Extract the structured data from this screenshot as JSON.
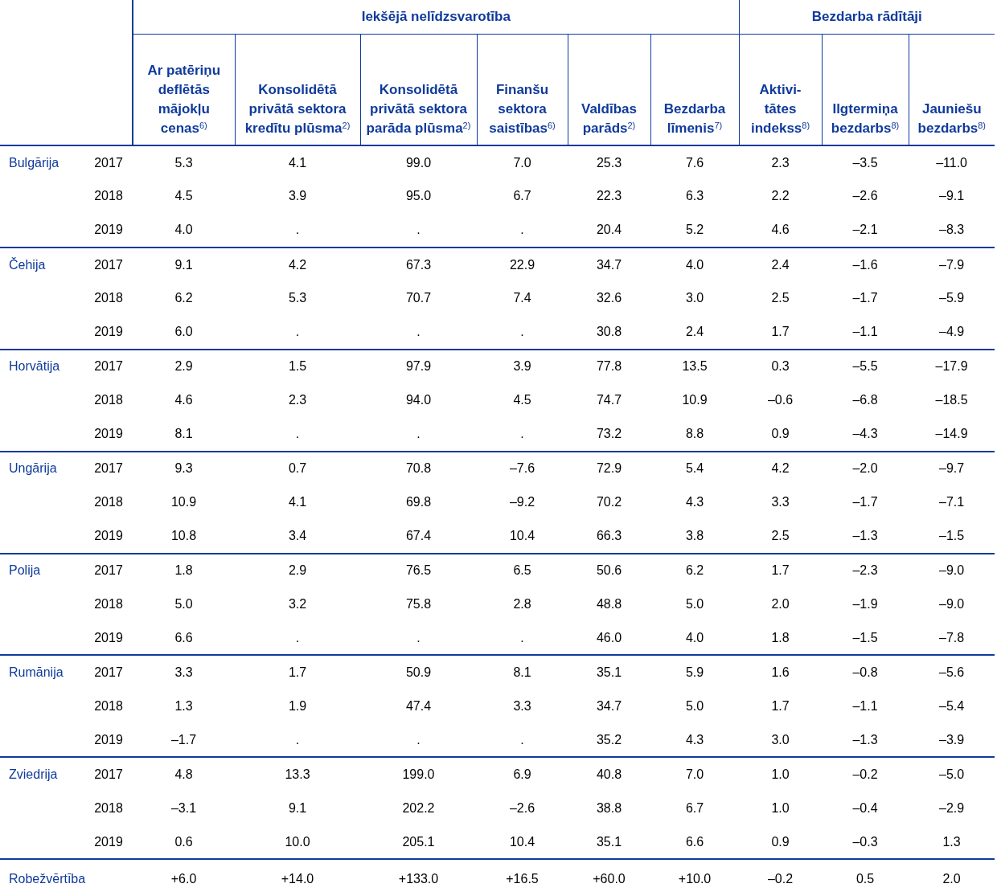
{
  "groups": [
    {
      "label": "Iekšējā nelīdzsvarotība",
      "columns": [
        "Ar patēriņu deflētās mājokļu cenas$^{6)}$",
        "Konsolidētā privātā sektora kredītu plūsma$^{2)}$",
        "Konsolidētā privātā sektora parāda plūsma$^{2)}$",
        "Finanšu sektora saistības$^{6)}$",
        "Valdības parāds$^{2)}$",
        "Bezdarba līmenis$^{7)}$"
      ]
    },
    {
      "label": "Bezdarba rādītāji",
      "columns": [
        "Aktivi-tātes indekss$^{8)}$",
        "Ilgtermiņa bezdarbs$^{8)}$",
        "Jauniešu bezdarbs$^{8)}$"
      ]
    }
  ],
  "countries": [
    {
      "name": "Bulgārija",
      "rows": [
        {
          "year": "2017",
          "values": [
            "5.3",
            "4.1",
            "99.0",
            "7.0",
            "25.3",
            "7.6",
            "2.3",
            "–3.5",
            "–11.0"
          ]
        },
        {
          "year": "2018",
          "values": [
            "4.5",
            "3.9",
            "95.0",
            "6.7",
            "22.3",
            "6.3",
            "2.2",
            "–2.6",
            "–9.1"
          ]
        },
        {
          "year": "2019",
          "values": [
            "4.0",
            ".",
            ".",
            ".",
            "20.4",
            "5.2",
            "4.6",
            "–2.1",
            "–8.3"
          ]
        }
      ]
    },
    {
      "name": "Čehija",
      "rows": [
        {
          "year": "2017",
          "values": [
            "9.1",
            "4.2",
            "67.3",
            "22.9",
            "34.7",
            "4.0",
            "2.4",
            "–1.6",
            "–7.9"
          ]
        },
        {
          "year": "2018",
          "values": [
            "6.2",
            "5.3",
            "70.7",
            "7.4",
            "32.6",
            "3.0",
            "2.5",
            "–1.7",
            "–5.9"
          ]
        },
        {
          "year": "2019",
          "values": [
            "6.0",
            ".",
            ".",
            ".",
            "30.8",
            "2.4",
            "1.7",
            "–1.1",
            "–4.9"
          ]
        }
      ]
    },
    {
      "name": "Horvātija",
      "rows": [
        {
          "year": "2017",
          "values": [
            "2.9",
            "1.5",
            "97.9",
            "3.9",
            "77.8",
            "13.5",
            "0.3",
            "–5.5",
            "–17.9"
          ]
        },
        {
          "year": "2018",
          "values": [
            "4.6",
            "2.3",
            "94.0",
            "4.5",
            "74.7",
            "10.9",
            "–0.6",
            "–6.8",
            "–18.5"
          ]
        },
        {
          "year": "2019",
          "values": [
            "8.1",
            ".",
            ".",
            ".",
            "73.2",
            "8.8",
            "0.9",
            "–4.3",
            "–14.9"
          ]
        }
      ]
    },
    {
      "name": "Ungārija",
      "rows": [
        {
          "year": "2017",
          "values": [
            "9.3",
            "0.7",
            "70.8",
            "–7.6",
            "72.9",
            "5.4",
            "4.2",
            "–2.0",
            "–9.7"
          ]
        },
        {
          "year": "2018",
          "values": [
            "10.9",
            "4.1",
            "69.8",
            "–9.2",
            "70.2",
            "4.3",
            "3.3",
            "–1.7",
            "–7.1"
          ]
        },
        {
          "year": "2019",
          "values": [
            "10.8",
            "3.4",
            "67.4",
            "10.4",
            "66.3",
            "3.8",
            "2.5",
            "–1.3",
            "–1.5"
          ]
        }
      ]
    },
    {
      "name": "Polija",
      "rows": [
        {
          "year": "2017",
          "values": [
            "1.8",
            "2.9",
            "76.5",
            "6.5",
            "50.6",
            "6.2",
            "1.7",
            "–2.3",
            "–9.0"
          ]
        },
        {
          "year": "2018",
          "values": [
            "5.0",
            "3.2",
            "75.8",
            "2.8",
            "48.8",
            "5.0",
            "2.0",
            "–1.9",
            "–9.0"
          ]
        },
        {
          "year": "2019",
          "values": [
            "6.6",
            ".",
            ".",
            ".",
            "46.0",
            "4.0",
            "1.8",
            "–1.5",
            "–7.8"
          ]
        }
      ]
    },
    {
      "name": "Rumānija",
      "rows": [
        {
          "year": "2017",
          "values": [
            "3.3",
            "1.7",
            "50.9",
            "8.1",
            "35.1",
            "5.9",
            "1.6",
            "–0.8",
            "–5.6"
          ]
        },
        {
          "year": "2018",
          "values": [
            "1.3",
            "1.9",
            "47.4",
            "3.3",
            "34.7",
            "5.0",
            "1.7",
            "–1.1",
            "–5.4"
          ]
        },
        {
          "year": "2019",
          "values": [
            "–1.7",
            ".",
            ".",
            ".",
            "35.2",
            "4.3",
            "3.0",
            "–1.3",
            "–3.9"
          ]
        }
      ]
    },
    {
      "name": "Zviedrija",
      "rows": [
        {
          "year": "2017",
          "values": [
            "4.8",
            "13.3",
            "199.0",
            "6.9",
            "40.8",
            "7.0",
            "1.0",
            "–0.2",
            "–5.0"
          ]
        },
        {
          "year": "2018",
          "values": [
            "–3.1",
            "9.1",
            "202.2",
            "–2.6",
            "38.8",
            "6.7",
            "1.0",
            "–0.4",
            "–2.9"
          ]
        },
        {
          "year": "2019",
          "values": [
            "0.6",
            "10.0",
            "205.1",
            "10.4",
            "35.1",
            "6.6",
            "0.9",
            "–0.3",
            "1.3"
          ]
        }
      ]
    }
  ],
  "threshold": {
    "label": "Robežvērtība",
    "values": [
      "+6.0",
      "+14.0",
      "+133.0",
      "+16.5",
      "+60.0",
      "+10.0",
      "–0.2",
      "0.5",
      "2.0"
    ]
  }
}
